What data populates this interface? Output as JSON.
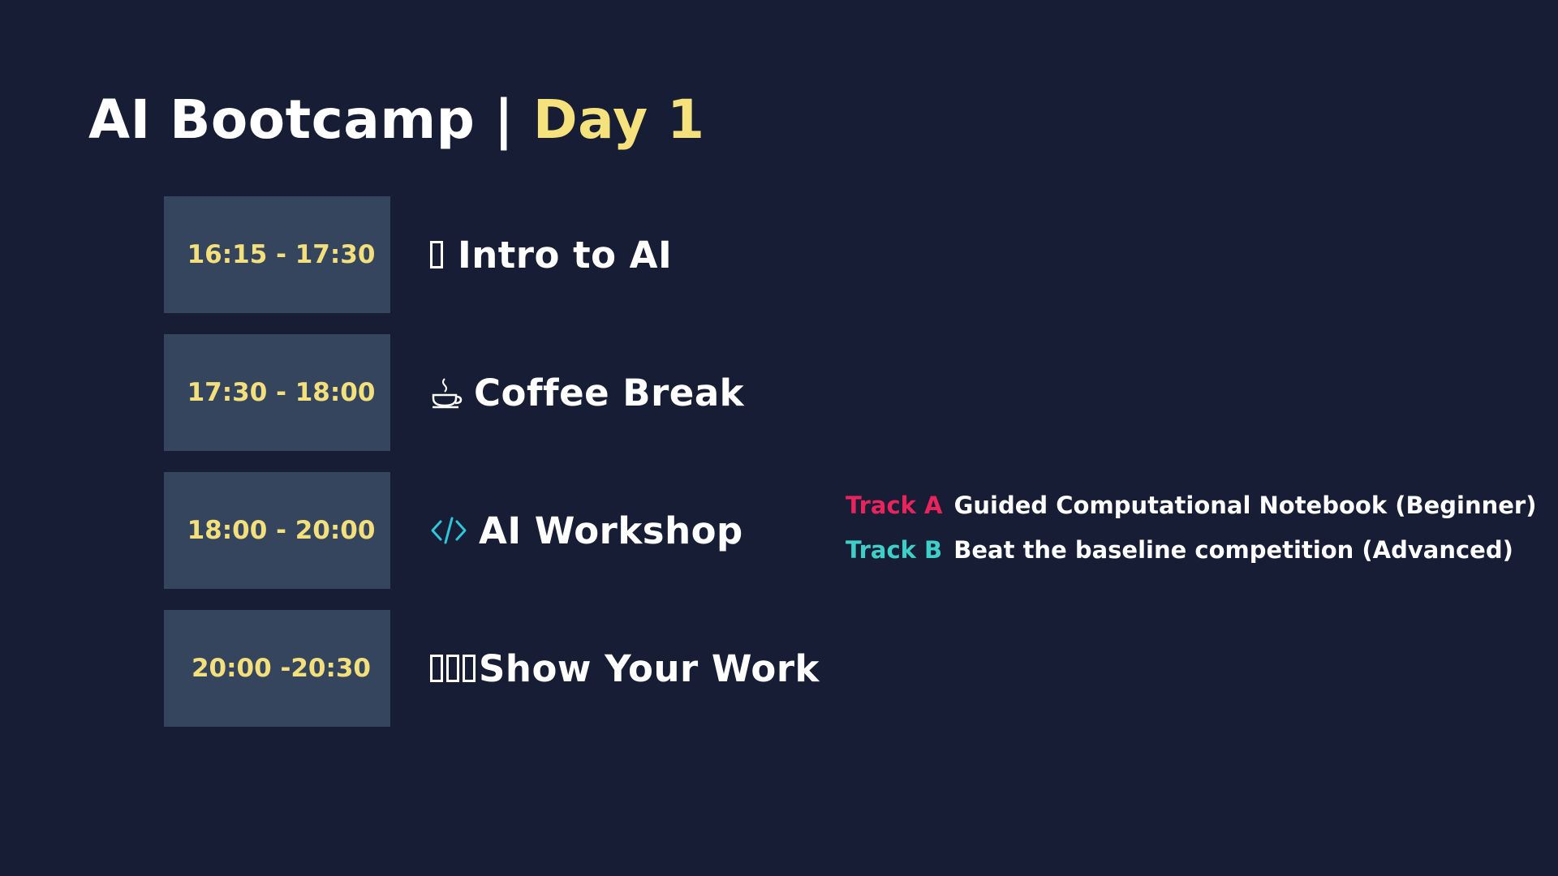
{
  "title": {
    "main": "AI Bootcamp | ",
    "accent": "Day 1"
  },
  "colors": {
    "background": "#161d35",
    "time_box": "#35455d",
    "time_text": "#f3e07c",
    "title_accent": "#f6e27c",
    "track_a": "#e9245c",
    "track_b": "#3fcfc6"
  },
  "schedule": [
    {
      "time": "16:15 - 17:30",
      "icon": "missing-glyph-icon",
      "title": "Intro to AI"
    },
    {
      "time": "17:30 - 18:00",
      "icon": "coffee-cup-icon",
      "title": "Coffee Break"
    },
    {
      "time": "18:00 - 20:00",
      "icon": "code-brackets-icon",
      "title": "AI Workshop"
    },
    {
      "time": "20:00 -20:30",
      "icon": "missing-glyph-icon",
      "title": "Show Your Work"
    }
  ],
  "tracks": [
    {
      "label": "Track A",
      "description": "Guided Computational Notebook (Beginner)"
    },
    {
      "label": "Track B",
      "description": "Beat the baseline competition (Advanced)"
    }
  ]
}
